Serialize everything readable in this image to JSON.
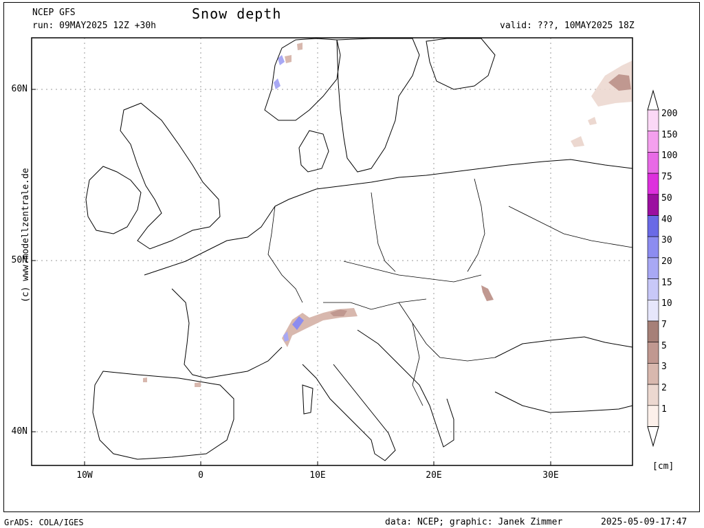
{
  "header": {
    "model": "NCEP GFS",
    "run": "run: 09MAY2025 12Z +30h",
    "title": "Snow depth",
    "valid": "valid: ???, 10MAY2025 18Z"
  },
  "axes": {
    "lat_labels": [
      "60N",
      "50N",
      "40N"
    ],
    "lon_labels": [
      "10W",
      "0",
      "10E",
      "20E",
      "30E"
    ]
  },
  "credit": "(c) www.modellzentrale.de",
  "legend": {
    "levels": [
      "200",
      "150",
      "100",
      "75",
      "50",
      "40",
      "30",
      "20",
      "15",
      "10",
      "7",
      "5",
      "3",
      "2",
      "1"
    ],
    "colors": [
      "#fbd8f6",
      "#f4a0ee",
      "#e86ae6",
      "#dd30dd",
      "#9b0fa0",
      "#6a6ae6",
      "#8c8cf0",
      "#a8a8f4",
      "#c8c8f8",
      "#e6e6fb",
      "#a68078",
      "#c09890",
      "#d8b8ae",
      "#ecd8d0",
      "#fcf0ea"
    ],
    "unit": "[cm]"
  },
  "footer": {
    "left": "GrADS: COLA/IGES",
    "center": "data: NCEP; graphic: Janek Zimmer",
    "right": "2025-05-09-17:47"
  }
}
